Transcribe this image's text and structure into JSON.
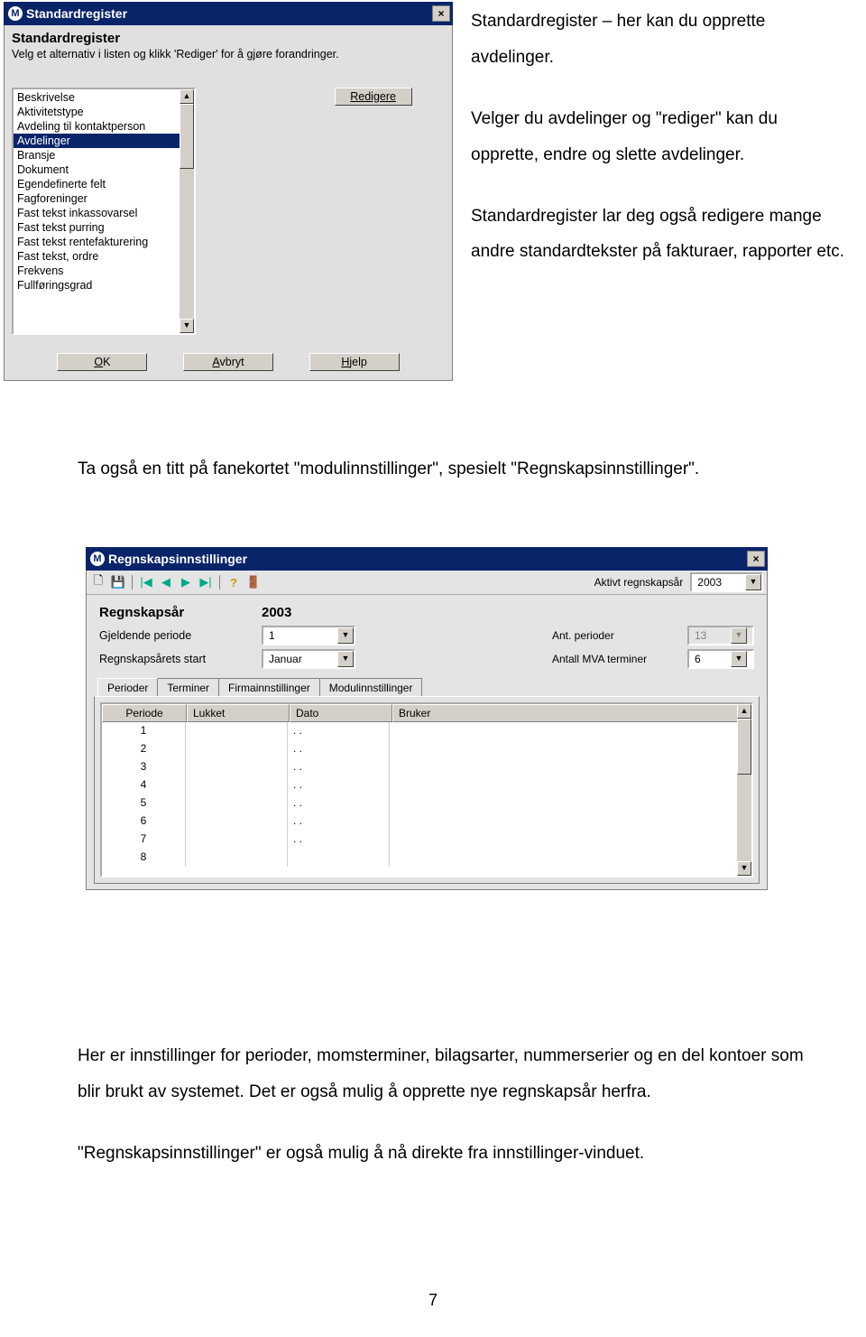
{
  "page_number": "7",
  "side_text": {
    "p1": "Standardregister – her kan du opprette avdelinger.",
    "p2": "Velger du avdelinger og \"rediger\" kan du opprette, endre og slette avdelinger.",
    "p3": "Standardregister lar deg også redigere mange andre standardtekster på fakturaer, rapporter etc."
  },
  "mid_text": "Ta også en titt på fanekortet \"modulinnstillinger\", spesielt \"Regnskapsinnstillinger\".",
  "bottom_text": {
    "p1": "Her er innstillinger for perioder, momsterminer, bilagsarter, nummerserier og en del kontoer som blir brukt av systemet. Det er også mulig å opprette nye regnskapsår herfra.",
    "p2": "\"Regnskapsinnstillinger\" er også mulig å nå direkte fra innstillinger-vinduet."
  },
  "win1": {
    "title": "Standardregister",
    "icon_letter": "M",
    "heading": "Standardregister",
    "sub": "Velg et alternativ i listen og klikk 'Rediger' for å gjøre forandringer.",
    "list": [
      "Beskrivelse",
      "Aktivitetstype",
      "Avdeling til kontaktperson",
      "Avdelinger",
      "Bransje",
      "Dokument",
      "Egendefinerte felt",
      "Fagforeninger",
      "Fast tekst inkassovarsel",
      "Fast tekst purring",
      "Fast tekst rentefakturering",
      "Fast tekst, ordre",
      "Frekvens",
      "Fullføringsgrad"
    ],
    "selected": 3,
    "btn_edit": "Redigere",
    "btn_ok_u": "O",
    "btn_ok_rest": "K",
    "btn_cancel_u": "A",
    "btn_cancel_rest": "vbryt",
    "btn_help_u": "H",
    "btn_help_rest": "jelp"
  },
  "win2": {
    "title": "Regnskapsinnstillinger",
    "icon_letter": "M",
    "toolbar": {
      "new": "🗋",
      "save": "💾",
      "sep": "|",
      "first": "|◀",
      "prev": "◀",
      "next": "▶",
      "last": "▶|",
      "help": "?",
      "exit": "🚪",
      "label": "Aktivt regnskapsår",
      "year": "2003"
    },
    "header": {
      "year_label": "Regnskapsår",
      "year_value": "2003",
      "row1_l_label": "Gjeldende periode",
      "row1_l_value": "1",
      "row1_r_label": "Ant. perioder",
      "row1_r_value": "13",
      "row2_l_label": "Regnskapsårets start",
      "row2_l_value": "Januar",
      "row2_r_label": "Antall MVA terminer",
      "row2_r_value": "6"
    },
    "tabs": [
      "Perioder",
      "Terminer",
      "Firmainnstillinger",
      "Modulinnstillinger"
    ],
    "active_tab": 0,
    "columns": [
      "Periode",
      "Lukket",
      "Dato",
      "Bruker"
    ],
    "rows": [
      {
        "periode": "1",
        "lukket": "",
        "dato": ". .",
        "bruker": ""
      },
      {
        "periode": "2",
        "lukket": "",
        "dato": ". .",
        "bruker": ""
      },
      {
        "periode": "3",
        "lukket": "",
        "dato": ". .",
        "bruker": ""
      },
      {
        "periode": "4",
        "lukket": "",
        "dato": ". .",
        "bruker": ""
      },
      {
        "periode": "5",
        "lukket": "",
        "dato": ". .",
        "bruker": ""
      },
      {
        "periode": "6",
        "lukket": "",
        "dato": ". .",
        "bruker": ""
      },
      {
        "periode": "7",
        "lukket": "",
        "dato": ". .",
        "bruker": ""
      },
      {
        "periode": "8",
        "lukket": "",
        "dato": "",
        "bruker": ""
      }
    ]
  }
}
